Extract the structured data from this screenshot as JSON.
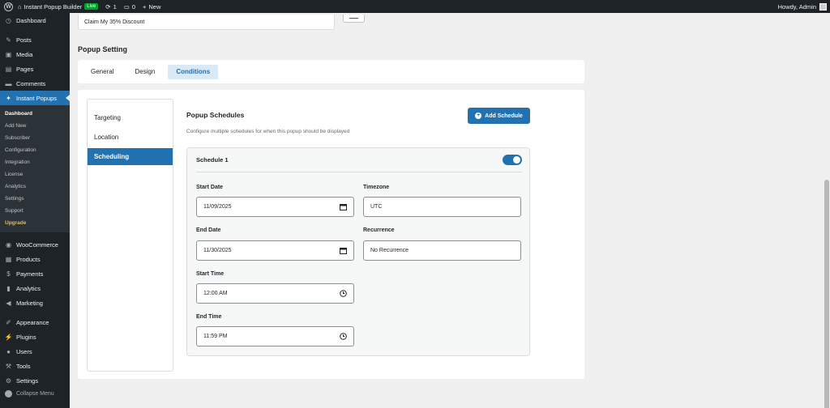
{
  "adminbar": {
    "site_name": "Instant Popup Builder",
    "live_badge": "Live",
    "updates_count": "1",
    "comments_count": "0",
    "new_label": "New",
    "howdy": "Howdy, Admin"
  },
  "sidebar": {
    "dashboard": "Dashboard",
    "posts": "Posts",
    "media": "Media",
    "pages": "Pages",
    "comments": "Comments",
    "instant_popups": "Instant Popups",
    "sub": [
      "Dashboard",
      "Add New",
      "Subscriber",
      "Configuration",
      "Integration",
      "License",
      "Analytics",
      "Settings",
      "Support",
      "Upgrade"
    ],
    "woocommerce": "WooCommerce",
    "products": "Products",
    "payments": "Payments",
    "analytics": "Analytics",
    "marketing": "Marketing",
    "appearance": "Appearance",
    "plugins": "Plugins",
    "users": "Users",
    "tools": "Tools",
    "settings": "Settings",
    "collapse": "Collapse Menu"
  },
  "main": {
    "top_input_value": "Claim My 35% Discount",
    "section_title": "Popup Setting",
    "tabs": [
      "General",
      "Design",
      "Conditions"
    ],
    "side_nav": [
      "Targeting",
      "Location",
      "Scheduling"
    ],
    "panel_title": "Popup Schedules",
    "panel_desc": "Configure multiple schedules for when this popup should be displayed",
    "add_button": "Add Schedule",
    "schedule": {
      "name": "Schedule 1",
      "enabled": true,
      "start_date_label": "Start Date",
      "start_date": "11/09/2025",
      "timezone_label": "Timezone",
      "timezone": "UTC",
      "end_date_label": "End Date",
      "end_date": "11/30/2025",
      "recurrence_label": "Recurrence",
      "recurrence": "No Recurrence",
      "start_time_label": "Start Time",
      "start_time": "12:00 AM",
      "end_time_label": "End Time",
      "end_time": "11:59 PM"
    }
  },
  "colors": {
    "accent": "#2271b1",
    "sidebar_bg": "#1d2327",
    "upgrade": "#f0b849"
  }
}
